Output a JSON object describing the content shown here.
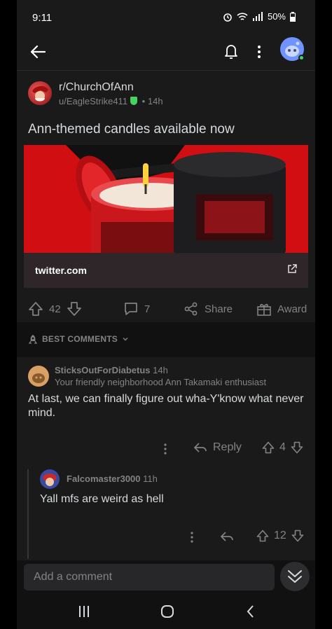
{
  "status_bar": {
    "time": "9:11",
    "battery": "50%"
  },
  "post": {
    "subreddit": "r/ChurchOfAnn",
    "author": "u/EagleStrike411",
    "separator": "•",
    "age": "14h",
    "title": "Ann-themed candles available now",
    "link_domain": "twitter.com",
    "upvotes": "42",
    "comments": "7",
    "share_label": "Share",
    "award_label": "Award"
  },
  "sort": {
    "label": "BEST COMMENTS"
  },
  "comments": [
    {
      "username": "SticksOutForDiabetus",
      "age": "14h",
      "flair": "Your friendly neighborhood Ann Takamaki enthusiast",
      "body": "At last, we can finally figure out wha-Y'know what never mind.",
      "reply_label": "Reply",
      "score": "4"
    },
    {
      "username": "Falcomaster3000",
      "age": "11h",
      "body": "Yall mfs are weird as hell",
      "score": "12"
    }
  ],
  "composer": {
    "placeholder": "Add a comment"
  },
  "colors": {
    "background": "#1a1a1b",
    "text": "#d7dadc",
    "muted": "#818384",
    "online": "#46d160",
    "media_red": "#d10f12"
  }
}
